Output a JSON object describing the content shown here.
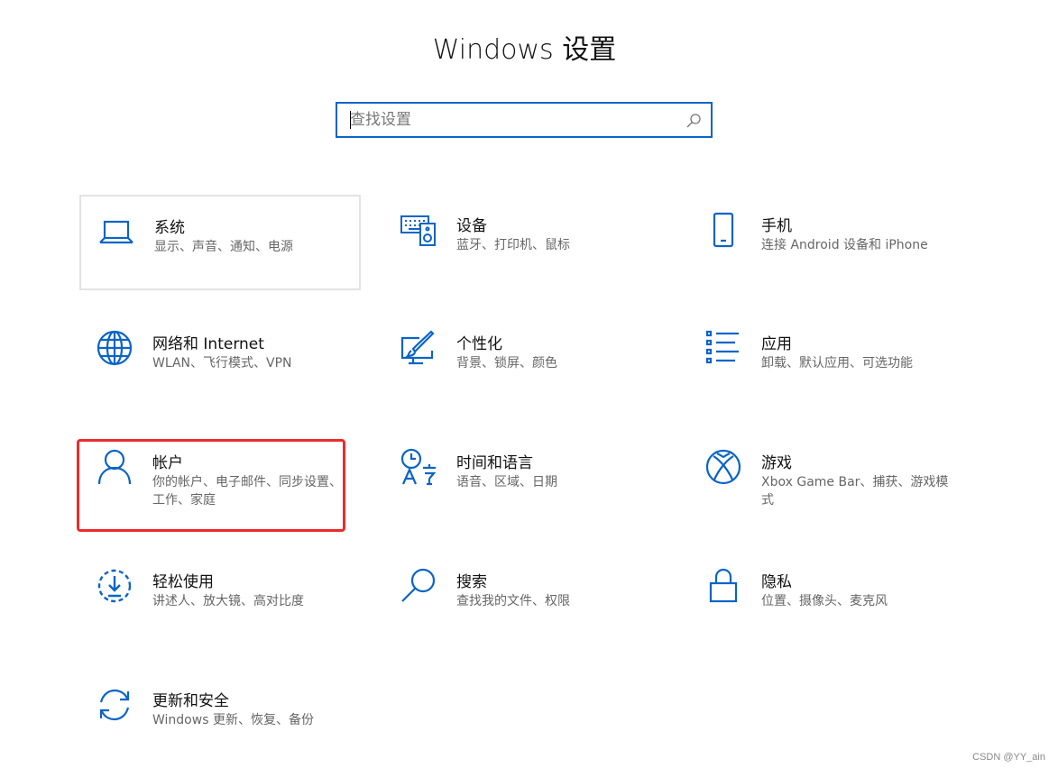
{
  "window_title": "Windows 设置",
  "search": {
    "placeholder": "查找设置"
  },
  "accent_color": "#0a64c8",
  "highlight_color": "#ee2b2b",
  "tiles": [
    {
      "name": "系统",
      "desc": "显示、声音、通知、电源",
      "icon": "laptop-icon"
    },
    {
      "name": "设备",
      "desc": "蓝牙、打印机、鼠标",
      "icon": "keyboard-speaker-icon"
    },
    {
      "name": "手机",
      "desc": "连接 Android 设备和 iPhone",
      "icon": "phone-icon"
    },
    {
      "name": "网络和 Internet",
      "desc": "WLAN、飞行模式、VPN",
      "icon": "globe-icon"
    },
    {
      "name": "个性化",
      "desc": "背景、锁屏、颜色",
      "icon": "paintbrush-monitor-icon"
    },
    {
      "name": "应用",
      "desc": "卸载、默认应用、可选功能",
      "icon": "app-list-icon"
    },
    {
      "name": "帐户",
      "desc": "你的帐户、电子邮件、同步设置、工作、家庭",
      "icon": "person-icon"
    },
    {
      "name": "时间和语言",
      "desc": "语音、区域、日期",
      "icon": "clock-language-icon"
    },
    {
      "name": "游戏",
      "desc": "Xbox Game Bar、捕获、游戏模式",
      "icon": "xbox-icon"
    },
    {
      "name": "轻松使用",
      "desc": "讲述人、放大镜、高对比度",
      "icon": "ease-of-access-icon"
    },
    {
      "name": "搜索",
      "desc": "查找我的文件、权限",
      "icon": "magnifier-icon"
    },
    {
      "name": "隐私",
      "desc": "位置、摄像头、麦克风",
      "icon": "lock-icon"
    },
    {
      "name": "更新和安全",
      "desc": "Windows 更新、恢复、备份",
      "icon": "refresh-icon"
    }
  ],
  "watermark": "CSDN @YY_ain"
}
